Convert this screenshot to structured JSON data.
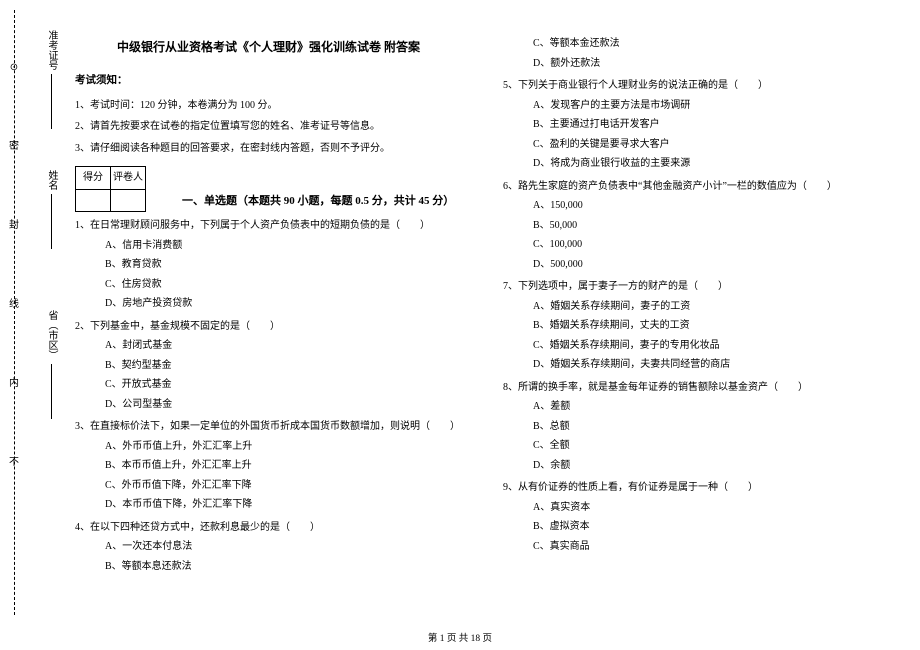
{
  "side": {
    "tags": [
      "密",
      "封",
      "线",
      "内",
      "不"
    ],
    "circle": "⊙",
    "fields": [
      {
        "label": "省（市区）"
      },
      {
        "label": "姓名"
      },
      {
        "label": "准考证号"
      },
      {
        "label": "考"
      }
    ]
  },
  "doc": {
    "title": "中级银行从业资格考试《个人理财》强化训练试卷 附答案",
    "notice_hd": "考试须知：",
    "notices": [
      "1、考试时间：120 分钟，本卷满分为 100 分。",
      "2、请首先按要求在试卷的指定位置填写您的姓名、准考证号等信息。",
      "3、请仔细阅读各种题目的回答要求，在密封线内答题，否则不予评分。"
    ],
    "score_labels": {
      "a": "得分",
      "b": "评卷人"
    },
    "section1": "一、单选题（本题共 90 小题，每题 0.5 分，共计 45 分）",
    "questions_left": [
      {
        "stem": "1、在日常理财顾问服务中，下列属于个人资产负债表中的短期负债的是（　　）",
        "opts": [
          "A、信用卡消费额",
          "B、教育贷款",
          "C、住房贷款",
          "D、房地产投资贷款"
        ]
      },
      {
        "stem": "2、下列基金中，基金规模不固定的是（　　）",
        "opts": [
          "A、封闭式基金",
          "B、契约型基金",
          "C、开放式基金",
          "D、公司型基金"
        ]
      },
      {
        "stem": "3、在直接标价法下，如果一定单位的外国货币折成本国货币数额增加，则说明（　　）",
        "opts": [
          "A、外币币值上升，外汇汇率上升",
          "B、本币币值上升，外汇汇率上升",
          "C、外币币值下降，外汇汇率下降",
          "D、本币币值下降，外汇汇率下降"
        ]
      },
      {
        "stem": "4、在以下四种还贷方式中，还款利息最少的是（　　）",
        "opts": [
          "A、一次还本付息法",
          "B、等额本息还款法"
        ]
      }
    ],
    "q4_extra_opts": [
      "C、等额本金还款法",
      "D、额外还款法"
    ],
    "questions_right": [
      {
        "stem": "5、下列关于商业银行个人理财业务的说法正确的是（　　）",
        "opts": [
          "A、发现客户的主要方法是市场调研",
          "B、主要通过打电话开发客户",
          "C、盈利的关键是要寻求大客户",
          "D、将成为商业银行收益的主要来源"
        ]
      },
      {
        "stem": "6、路先生家庭的资产负债表中“其他金融资产小计”一栏的数值应为（　　）",
        "opts": [
          "A、150,000",
          "B、50,000",
          "C、100,000",
          "D、500,000"
        ]
      },
      {
        "stem": "7、下列选项中，属于妻子一方的财产的是（　　）",
        "opts": [
          "A、婚姻关系存续期间，妻子的工资",
          "B、婚姻关系存续期间，丈夫的工资",
          "C、婚姻关系存续期间，妻子的专用化妆品",
          "D、婚姻关系存续期间，夫妻共同经营的商店"
        ]
      },
      {
        "stem": "8、所谓的换手率，就是基金每年证券的销售额除以基金资产（　　）",
        "opts": [
          "A、差额",
          "B、总额",
          "C、全额",
          "D、余额"
        ]
      },
      {
        "stem": "9、从有价证券的性质上看，有价证券是属于一种（　　）",
        "opts": [
          "A、真实资本",
          "B、虚拟资本",
          "C、真实商品"
        ]
      }
    ],
    "page_num": "第 1 页 共 18 页"
  }
}
